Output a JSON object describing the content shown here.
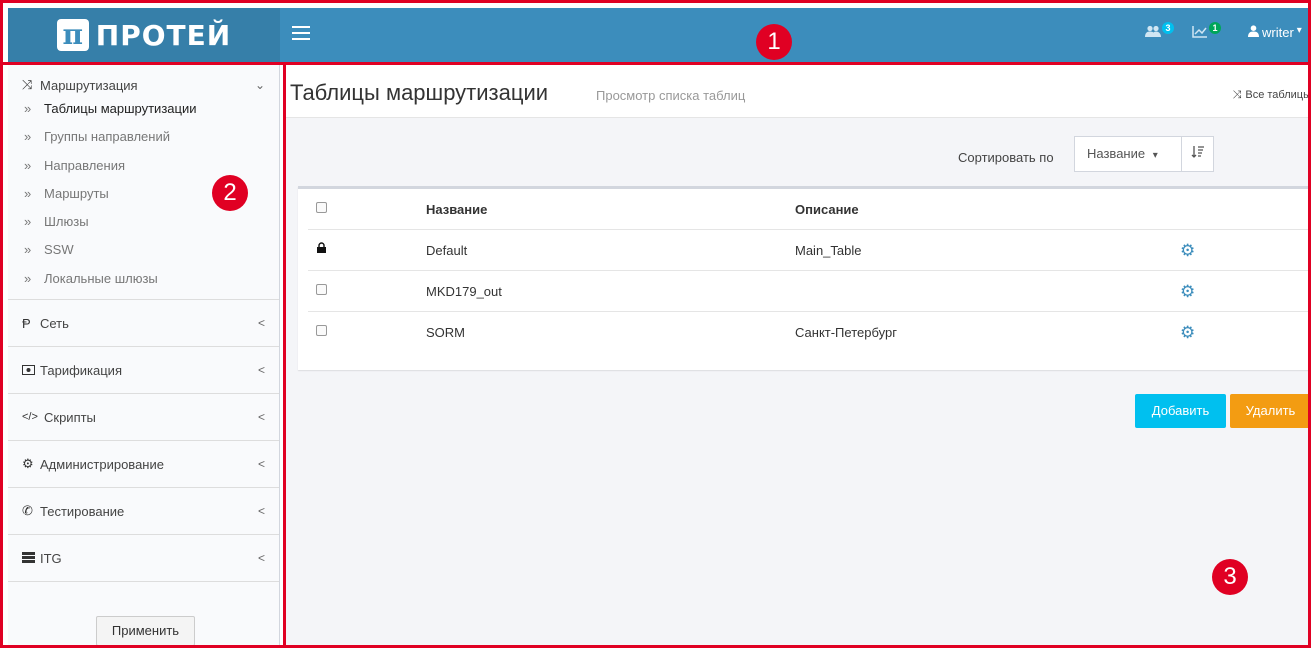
{
  "brand": {
    "name": "ПРОТЕЙ",
    "mark": "π"
  },
  "topbar": {
    "users_badge": "3",
    "stats_badge": "1",
    "user": "writer",
    "user_caret": "▾"
  },
  "sidebar": {
    "groups": [
      {
        "label": "Маршрутизация",
        "icon": "shuffle-icon",
        "chevron": "⌄",
        "items": [
          "Таблицы маршрутизации",
          "Группы направлений",
          "Направления",
          "Маршруты",
          "Шлюзы",
          "SSW",
          "Локальные шлюзы"
        ]
      },
      {
        "label": "Сеть",
        "icon": "network-icon",
        "chevron": "<"
      },
      {
        "label": "Тарификация",
        "icon": "money-icon",
        "chevron": "<"
      },
      {
        "label": "Скрипты",
        "icon": "code-icon",
        "chevron": "<"
      },
      {
        "label": "Администрирование",
        "icon": "gears-icon",
        "chevron": "<"
      },
      {
        "label": "Тестирование",
        "icon": "phone-icon",
        "chevron": "<"
      },
      {
        "label": "ITG",
        "icon": "server-icon",
        "chevron": "<"
      }
    ],
    "arrow": "»",
    "apply_label": "Применить"
  },
  "page": {
    "title": "Таблицы маршрутизации",
    "subtitle": "Просмотр списка таблиц",
    "all_tables": "Все таблицы",
    "sort_label": "Сортировать по",
    "sort_value": "Название",
    "sort_caret": "▾"
  },
  "table": {
    "col_name": "Название",
    "col_desc": "Описание",
    "rows": [
      {
        "name": "Default",
        "desc": "Main_Table",
        "locked": true
      },
      {
        "name": "MKD179_out",
        "desc": "",
        "locked": false
      },
      {
        "name": "SORM",
        "desc": "Санкт-Петербург",
        "locked": false
      }
    ]
  },
  "actions": {
    "add": "Добавить",
    "delete": "Удалить"
  },
  "annotations": [
    "1",
    "2",
    "3"
  ],
  "colors": {
    "topbar": "#3c8dbc",
    "logo_bg": "#367fa9",
    "add": "#00c0ef",
    "delete": "#f39c12",
    "annotation": "#e00023"
  }
}
